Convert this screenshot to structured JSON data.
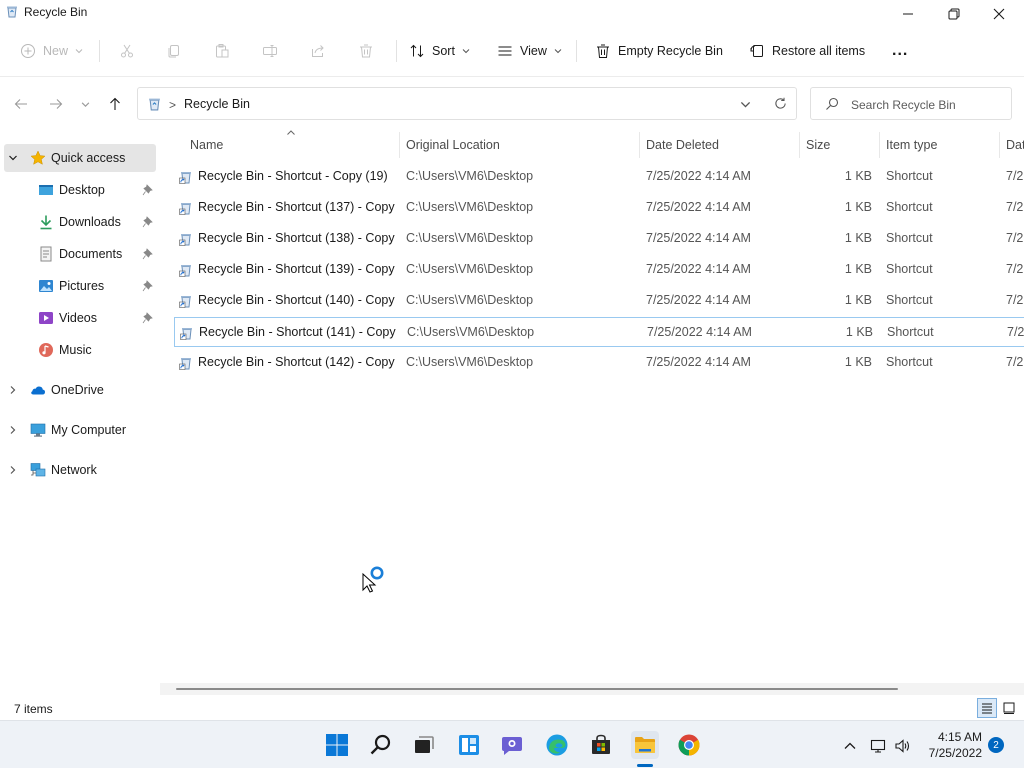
{
  "window": {
    "title": "Recycle Bin",
    "icon": "recycle-bin-icon",
    "controls": [
      "minimize-icon",
      "restore-icon",
      "close-icon"
    ]
  },
  "commandbar": {
    "new_label": "New",
    "sort_label": "Sort",
    "view_label": "View",
    "empty_label": "Empty Recycle Bin",
    "restore_all_label": "Restore all items",
    "more_label": "...",
    "disabled_icons": [
      "cut-icon",
      "copy-icon",
      "paste-icon",
      "rename-icon",
      "share-icon",
      "delete-icon"
    ]
  },
  "address": {
    "crumb": "Recycle Bin",
    "separator": ">",
    "search_placeholder": "Search Recycle Bin"
  },
  "navpane": {
    "quick_access": "Quick access",
    "desktop": "Desktop",
    "downloads": "Downloads",
    "documents": "Documents",
    "pictures": "Pictures",
    "videos": "Videos",
    "music": "Music",
    "onedrive": "OneDrive",
    "my_computer": "My Computer",
    "network": "Network"
  },
  "columns": {
    "name": "Name",
    "original_location": "Original Location",
    "date_deleted": "Date Deleted",
    "size": "Size",
    "item_type": "Item type",
    "date_truncated": "Dat"
  },
  "rows": [
    {
      "name": "Recycle Bin - Shortcut - Copy (19)",
      "location": "C:\\Users\\VM6\\Desktop",
      "date_deleted": "7/25/2022 4:14 AM",
      "size": "1 KB",
      "type": "Shortcut",
      "date_trunc": "7/2"
    },
    {
      "name": "Recycle Bin - Shortcut (137) - Copy",
      "location": "C:\\Users\\VM6\\Desktop",
      "date_deleted": "7/25/2022 4:14 AM",
      "size": "1 KB",
      "type": "Shortcut",
      "date_trunc": "7/2"
    },
    {
      "name": "Recycle Bin - Shortcut (138) - Copy",
      "location": "C:\\Users\\VM6\\Desktop",
      "date_deleted": "7/25/2022 4:14 AM",
      "size": "1 KB",
      "type": "Shortcut",
      "date_trunc": "7/2"
    },
    {
      "name": "Recycle Bin - Shortcut (139) - Copy",
      "location": "C:\\Users\\VM6\\Desktop",
      "date_deleted": "7/25/2022 4:14 AM",
      "size": "1 KB",
      "type": "Shortcut",
      "date_trunc": "7/2"
    },
    {
      "name": "Recycle Bin - Shortcut (140) - Copy",
      "location": "C:\\Users\\VM6\\Desktop",
      "date_deleted": "7/25/2022 4:14 AM",
      "size": "1 KB",
      "type": "Shortcut",
      "date_trunc": "7/2"
    },
    {
      "name": "Recycle Bin - Shortcut (141) - Copy",
      "location": "C:\\Users\\VM6\\Desktop",
      "date_deleted": "7/25/2022 4:14 AM",
      "size": "1 KB",
      "type": "Shortcut",
      "date_trunc": "7/2"
    },
    {
      "name": "Recycle Bin - Shortcut (142) - Copy",
      "location": "C:\\Users\\VM6\\Desktop",
      "date_deleted": "7/25/2022 4:14 AM",
      "size": "1 KB",
      "type": "Shortcut",
      "date_trunc": "7/2"
    }
  ],
  "status": {
    "item_count": "7 items"
  },
  "taskbar": {
    "apps": [
      "windows-start-icon",
      "search-icon",
      "task-view-icon",
      "widgets-icon",
      "teams-chat-icon",
      "edge-icon",
      "store-icon",
      "file-explorer-icon",
      "chrome-icon"
    ],
    "active_app": "file-explorer-icon",
    "time": "4:15 AM",
    "date": "7/25/2022",
    "notification_count": "2"
  },
  "colors": {
    "accent": "#0067c0",
    "selected_nav": "#e5e5e5",
    "row_focus_border": "#99c9f0",
    "folder_yellow": "#f8c53a"
  }
}
